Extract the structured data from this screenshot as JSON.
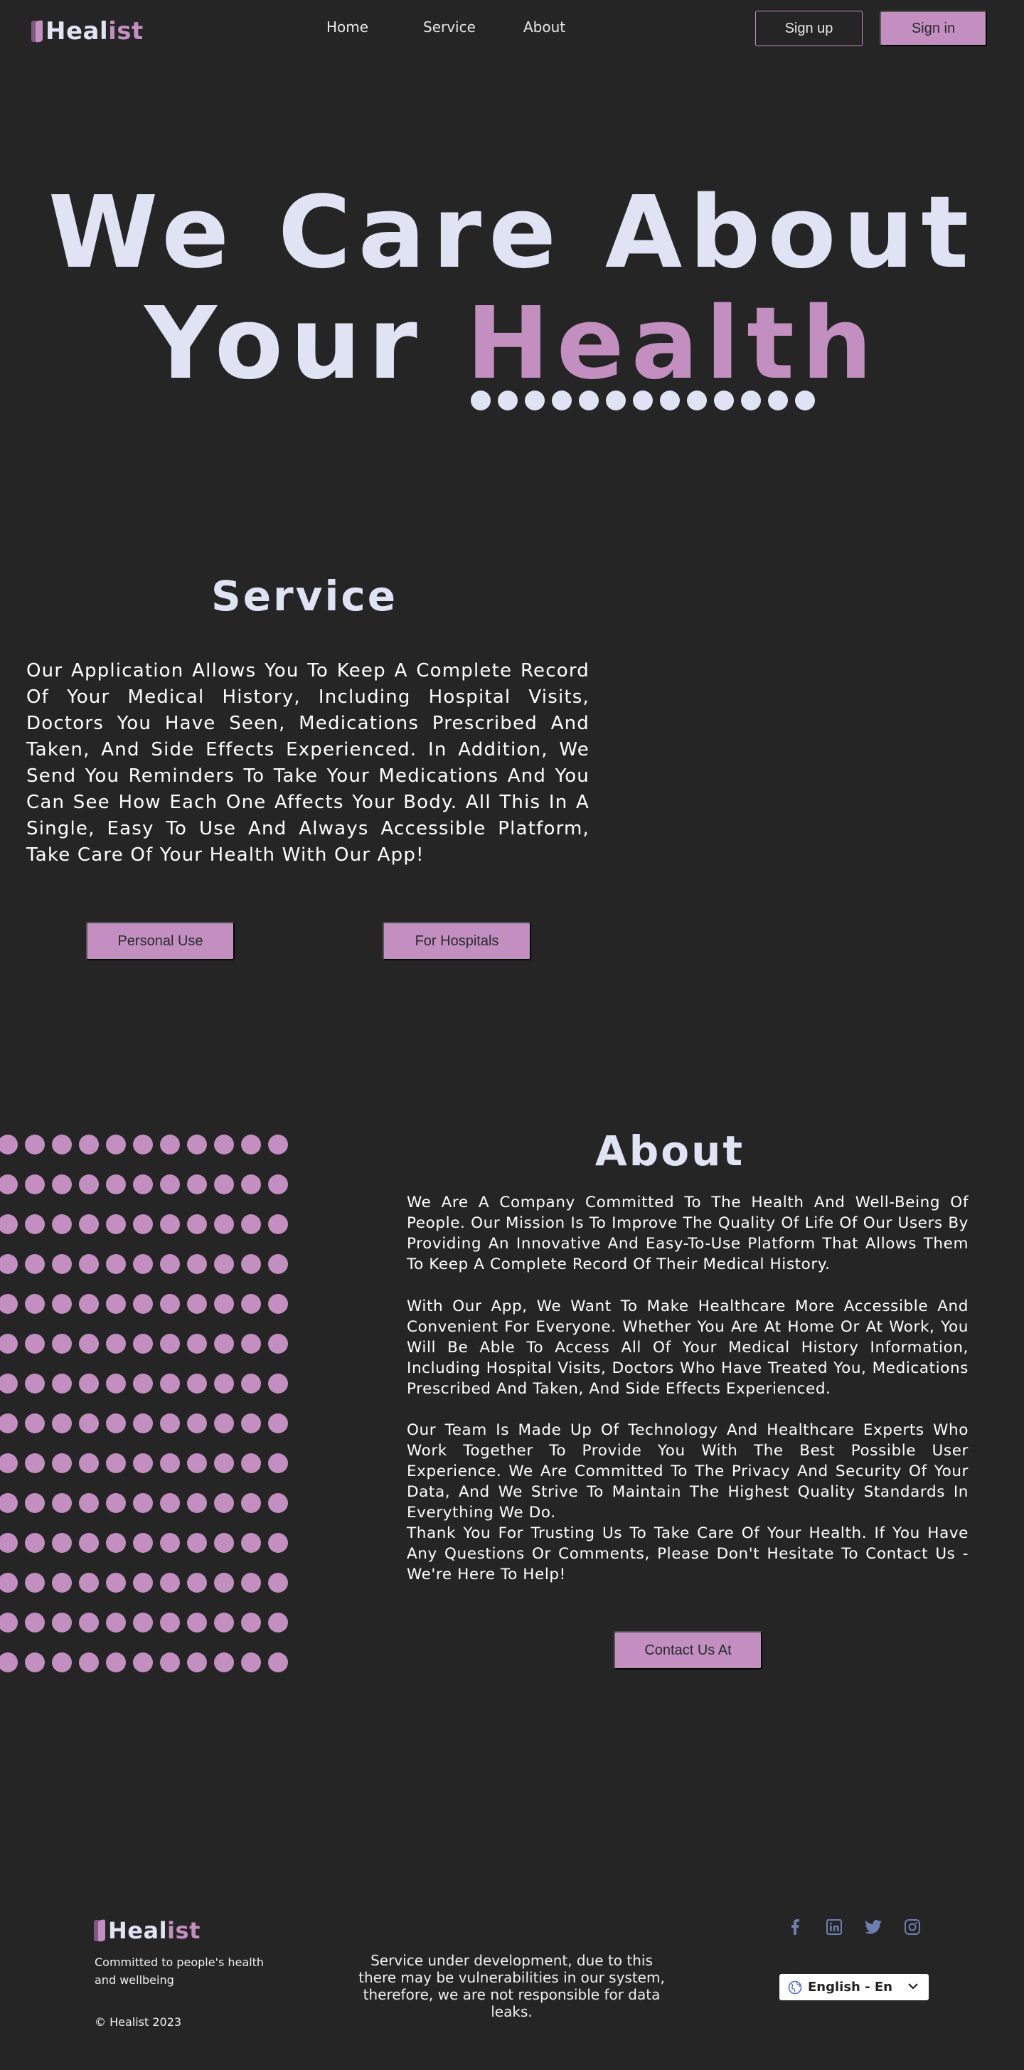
{
  "brand": {
    "heal": "Heal",
    "ist": "ist"
  },
  "nav": {
    "home": "Home",
    "service": "Service",
    "about": "About",
    "signup": "Sign up",
    "signin": "Sign in"
  },
  "hero": {
    "line1": "We Care About",
    "line2_a": "Your ",
    "line2_b": "Health"
  },
  "service": {
    "title": "Service",
    "text": "Our Application Allows You To Keep A Complete Record Of Your Medical History, Including Hospital Visits, Doctors You Have Seen, Medications Prescribed And Taken, And Side Effects Experienced. In Addition, We Send You Reminders To Take Your Medications And You Can See How Each One Affects Your Body. All This In A Single, Easy To Use And Always Accessible Platform, Take Care Of Your Health With Our App!",
    "personal_button": "Personal Use",
    "hospitals_button": "For Hospitals"
  },
  "about": {
    "title": "About",
    "paragraphs": [
      "We Are A Company Committed To The Health And Well-Being Of People. Our Mission Is To Improve The Quality Of Life Of Our Users By Providing An Innovative And Easy-To-Use Platform That Allows Them To Keep A Complete Record Of Their Medical History.",
      "With Our App, We Want To Make Healthcare More Accessible And Convenient For Everyone. Whether You Are At Home Or At Work, You Will Be Able To Access All Of Your Medical History Information, Including Hospital Visits, Doctors Who Have Treated You, Medications Prescribed And Taken, And Side Effects Experienced.",
      "Our Team Is Made Up Of Technology And Healthcare Experts Who Work Together To Provide You With The Best Possible User Experience. We Are Committed To The Privacy And Security Of Your Data, And We Strive To Maintain The Highest Quality Standards In Everything We Do.",
      "Thank You For Trusting Us To Take Care Of Your Health. If You Have Any Questions Or Comments, Please Don't Hesitate To Contact Us - We're Here To Help!"
    ],
    "contact_button": "Contact Us At"
  },
  "footer": {
    "tagline": "Committed to people's health and wellbeing",
    "copyright": "© Healist 2023",
    "notice": "Service under development, due to this there may be vulnerabilities in our system, therefore, we are not responsible for data leaks.",
    "language": "English - En",
    "social_icons": [
      "facebook-icon",
      "linkedin-icon",
      "twitter-icon",
      "instagram-icon"
    ]
  },
  "colors": {
    "background": "#252525",
    "accent": "#c28fc0",
    "headline": "#dfe3f3"
  }
}
